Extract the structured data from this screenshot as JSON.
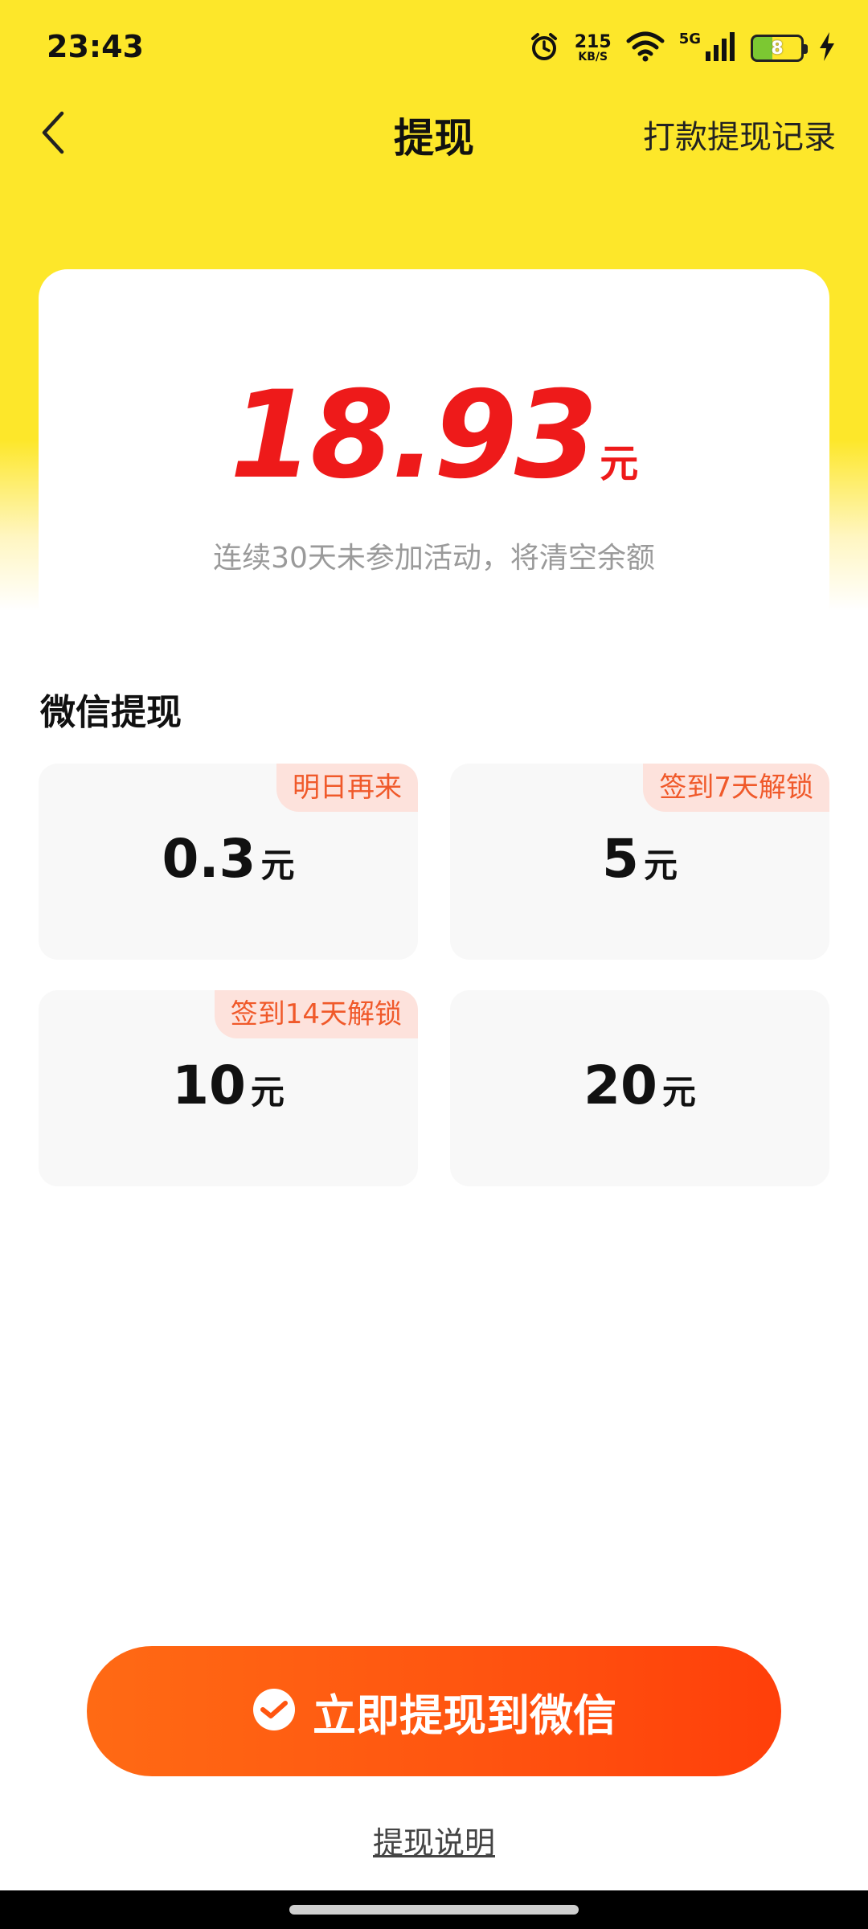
{
  "status_bar": {
    "time": "23:43",
    "net_speed": "215",
    "net_speed_unit": "KB/S",
    "network": "5G",
    "battery": "8"
  },
  "nav": {
    "title": "提现",
    "record_link": "打款提现记录"
  },
  "balance": {
    "amount": "18.93",
    "unit": "元",
    "note": "连续30天未参加活动，将清空余额"
  },
  "section": {
    "title": "微信提现"
  },
  "options": [
    {
      "amount": "0.3",
      "unit": "元",
      "badge": "明日再来"
    },
    {
      "amount": "5",
      "unit": "元",
      "badge": "签到7天解锁"
    },
    {
      "amount": "10",
      "unit": "元",
      "badge": "签到14天解锁"
    },
    {
      "amount": "20",
      "unit": "元"
    }
  ],
  "primary_button": {
    "label": "立即提现到微信",
    "icon": "wechat-pay-icon"
  },
  "help_link": "提现说明",
  "colors": {
    "header_yellow": "#fde72a",
    "balance_red": "#ee1a1a",
    "badge_bg": "#fde2dc",
    "badge_text": "#f0592a",
    "button_orange": "#ff5510"
  }
}
